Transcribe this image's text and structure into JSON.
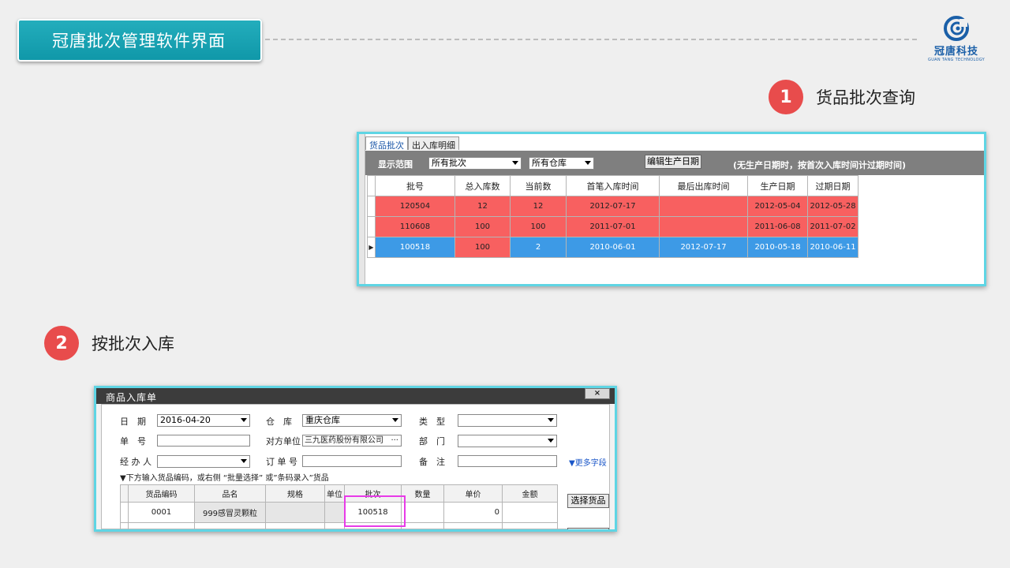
{
  "header": {
    "title": "冠唐批次管理软件界面"
  },
  "logo": {
    "name": "冠唐科技",
    "sub": "GUAN TANG TECHNOLOGY"
  },
  "step1": {
    "num": "1",
    "label": "货品批次查询"
  },
  "step2": {
    "num": "2",
    "label": "按批次入库"
  },
  "batch_window": {
    "tabs": [
      "货品批次",
      "出入库明细"
    ],
    "range_label": "显示范围",
    "batch_filter": "所有批次",
    "warehouse_filter": "所有仓库",
    "edit_button": "编辑生产日期",
    "hint": "(无生产日期时，按首次入库时间计过期时间)",
    "columns": [
      "批号",
      "总入库数",
      "当前数",
      "首笔入库时间",
      "最后出库时间",
      "生产日期",
      "过期日期"
    ],
    "rows": [
      [
        "120504",
        "12",
        "12",
        "2012-07-17",
        "",
        "2012-05-04",
        "2012-05-28"
      ],
      [
        "110608",
        "100",
        "100",
        "2011-07-01",
        "",
        "2011-06-08",
        "2011-07-02"
      ],
      [
        "100518",
        "100",
        "2",
        "2010-06-01",
        "2012-07-17",
        "2010-05-18",
        "2010-06-11"
      ]
    ]
  },
  "entry_window": {
    "title": "商品入库单",
    "close": "×",
    "date_label": "日　期",
    "date_value": "2016-04-20",
    "warehouse_label": "仓　库",
    "warehouse_value": "重庆仓库",
    "type_label": "类　型",
    "type_value": "",
    "number_label": "单　号",
    "number_value": "",
    "partner_label": "对方单位",
    "partner_value": "三九医药股份有限公司",
    "dept_label": "部　门",
    "dept_value": "",
    "handler_label": "经 办 人",
    "handler_value": "",
    "order_label": "订 单 号",
    "order_value": "",
    "note_label": "备　注",
    "note_value": "",
    "more_fields": "▼更多字段",
    "instruction": "▼下方输入货品编码，或右侧 “批量选择” 或”条码录入”货品",
    "select_button": "选择货品",
    "columns": [
      "货品编码",
      "品名",
      "规格",
      "单位",
      "批次",
      "数量",
      "单价",
      "金额"
    ],
    "rows": [
      [
        "0001",
        "999感冒灵颗粒",
        "",
        "",
        "100518",
        "",
        "0",
        ""
      ]
    ]
  }
}
